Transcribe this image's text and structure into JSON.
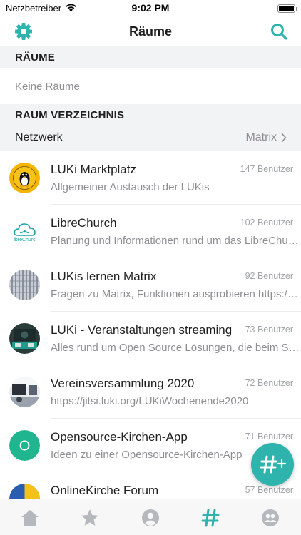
{
  "status_bar": {
    "carrier": "Netzbetreiber",
    "time": "9:02 PM"
  },
  "nav": {
    "title": "Räume",
    "settings_icon": "gear-icon",
    "search_icon": "search-icon",
    "accent_color": "#2fb3ad"
  },
  "sections": {
    "rooms_header": "RÄUME",
    "rooms_empty": "Keine Räume",
    "directory_header": "RAUM VERZEICHNIS",
    "network_label": "Netzwerk",
    "network_value": "Matrix"
  },
  "rooms": [
    {
      "name": "LUKi Marktplatz",
      "members": "147 Benutzer",
      "topic": "Allgemeiner Austausch der LUKis",
      "avatar": "penguin-logo"
    },
    {
      "name": "LibreChurch",
      "members": "102 Benutzer",
      "topic": "Planung und Informationen rund um das LibreChurch-Projekt",
      "avatar": "librechurch-logo",
      "avatar_text": "ibreChurc"
    },
    {
      "name": "LUKis lernen Matrix",
      "members": "92 Benutzer",
      "topic": "Fragen zu Matrix, Funktionen ausprobieren https://matrix.org",
      "avatar": "building-photo"
    },
    {
      "name": "LUKi - Veranstaltungen streaming",
      "members": "73 Benutzer",
      "topic": "Alles rund um Open Source Lösungen, die beim Streaming helfen",
      "avatar": "stream-photo"
    },
    {
      "name": "Vereinsversammlung 2020",
      "members": "72 Benutzer",
      "topic": "https://jitsi.luki.org/LUKiWochenende2020",
      "avatar": "room-photo"
    },
    {
      "name": "Opensource-Kirchen-App",
      "members": "71 Benutzer",
      "topic": "Ideen zu einer Opensource-Kirchen-App",
      "avatar": "letter-avatar",
      "avatar_letter": "O",
      "avatar_color": "#1fb58f"
    },
    {
      "name": "OnlineKirche Forum",
      "members": "57 Benutzer",
      "topic": "",
      "avatar": "pie-logo"
    }
  ],
  "fab": {
    "label": "#+",
    "icon": "create-room-icon"
  },
  "tabs": [
    {
      "icon": "home-icon"
    },
    {
      "icon": "star-icon"
    },
    {
      "icon": "person-icon"
    },
    {
      "icon": "hashtag-icon",
      "active": true
    },
    {
      "icon": "group-icon"
    }
  ]
}
